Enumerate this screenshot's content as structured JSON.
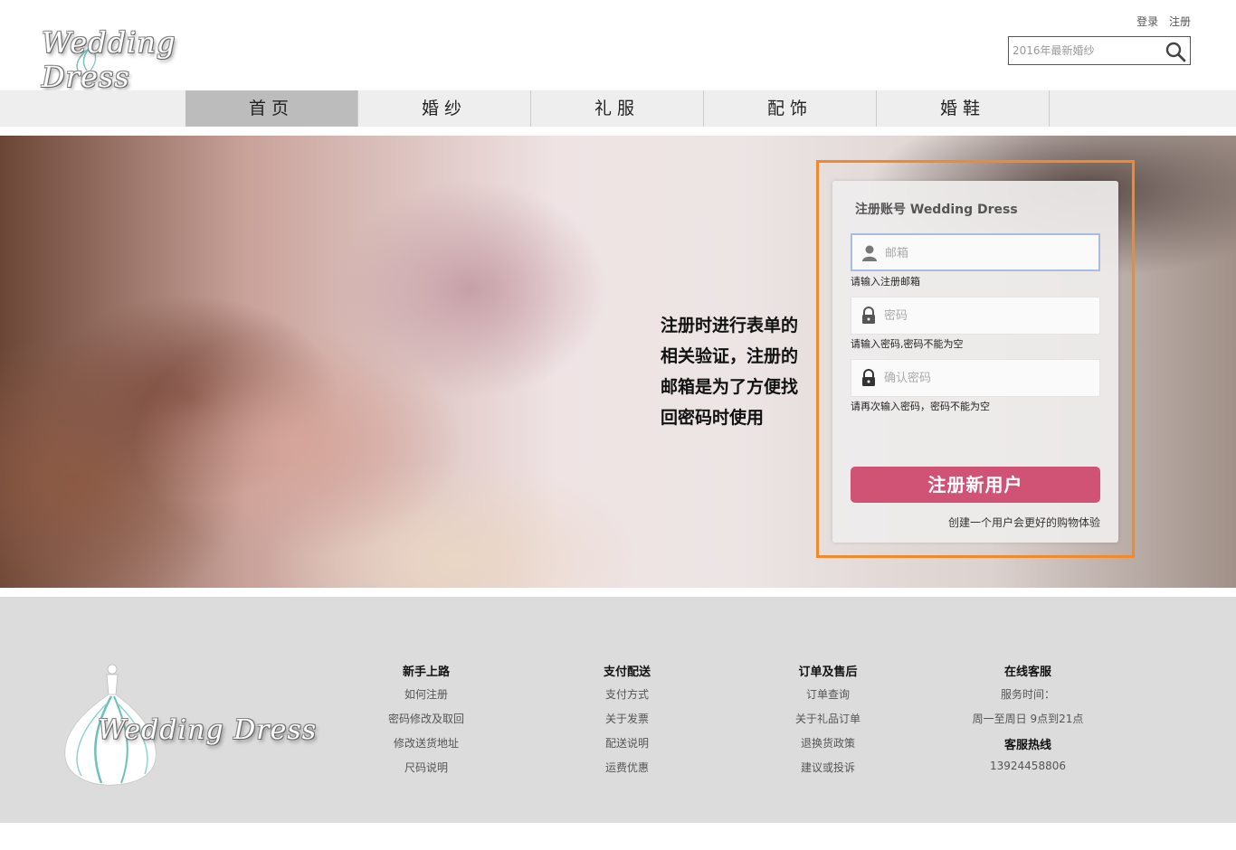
{
  "header": {
    "logo_text": "Wedding Dress",
    "login": "登录",
    "register": "注册",
    "search_placeholder": "2016年最新婚纱"
  },
  "nav": {
    "items": [
      {
        "label": "首页",
        "active": true
      },
      {
        "label": "婚纱"
      },
      {
        "label": "礼服"
      },
      {
        "label": "配饰"
      },
      {
        "label": "婚鞋"
      }
    ]
  },
  "hero": {
    "note": "注册时进行表单的相关验证，注册的邮箱是为了方便找回密码时使用",
    "form": {
      "title": "注册账号 Wedding Dress",
      "email_placeholder": "邮箱",
      "email_hint": "请输入注册邮箱",
      "password_placeholder": "密码",
      "password_hint": "请输入密码,密码不能为空",
      "confirm_placeholder": "确认密码",
      "confirm_hint": "请再次输入密码，密码不能为空",
      "submit_label": "注册新用户",
      "tip": "创建一个用户会更好的购物体验"
    },
    "highlight_color": "#f28a2d",
    "button_color": "#d05275"
  },
  "footer": {
    "logo_text": "Wedding Dress",
    "columns": [
      {
        "heading": "新手上路",
        "links": [
          "如何注册",
          "密码修改及取回",
          "修改送货地址",
          "尺码说明"
        ]
      },
      {
        "heading": "支付配送",
        "links": [
          "支付方式",
          "关于发票",
          "配送说明",
          "运费优惠"
        ]
      },
      {
        "heading": "订单及售后",
        "links": [
          "订单查询",
          "关于礼品订单",
          "退换货政策",
          "建议或投诉"
        ]
      },
      {
        "heading": "在线客服",
        "service_time_label": "服务时间：",
        "service_time": "周一至周日 9点到21点",
        "hotline_heading": "客服热线",
        "hotline": "13924458806"
      }
    ]
  }
}
